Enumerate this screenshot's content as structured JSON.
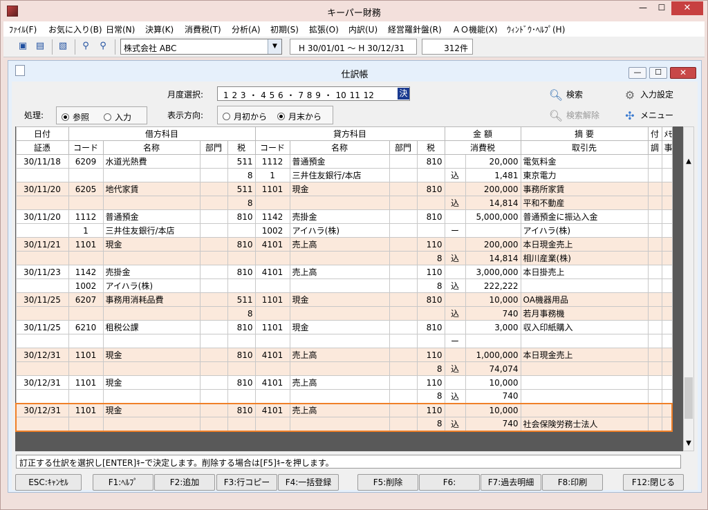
{
  "window": {
    "title": "キーパー財務",
    "min": "—",
    "max": "☐",
    "close": "✕"
  },
  "menu": [
    {
      "label": "ﾌｧｲﾙ(F)"
    },
    {
      "label": "お気に入り(B)"
    },
    {
      "label": "日常(N)"
    },
    {
      "label": "決算(K)"
    },
    {
      "label": "消費税(T)"
    },
    {
      "label": "分析(A)"
    },
    {
      "label": "初期(S)"
    },
    {
      "label": "拡張(O)"
    },
    {
      "label": "内訳(U)"
    },
    {
      "label": "経営羅針盤(R)"
    },
    {
      "label": "ＡＯ機能(X)"
    },
    {
      "label": "ｳｨﾝﾄﾞｳ･ﾍﾙﾌﾟ(H)"
    }
  ],
  "toolbar": {
    "company": "株式会社 ABC",
    "period": "H 30/01/01 〜 H 30/12/31",
    "count": "312件"
  },
  "journal": {
    "title": "仕訳帳",
    "month_label": "月度選択:",
    "months_text": "1 2 3 ・ 4 5 6 ・ 7 8 9 ・ 10 11 12",
    "month_selected": "決",
    "process_label": "処理:",
    "process_options": [
      {
        "label": "参照",
        "selected": true
      },
      {
        "label": "入力",
        "selected": false
      }
    ],
    "direction_label": "表示方向:",
    "direction_options": [
      {
        "label": "月初から",
        "selected": false
      },
      {
        "label": "月末から",
        "selected": true
      }
    ],
    "search_label": "検索",
    "search_clear_label": "検索解除",
    "input_settings_label": "入力設定",
    "menu_label": "メニュー",
    "header1": {
      "date": "日付",
      "debit": "借方科目",
      "credit": "貸方科目",
      "amount": "金 額",
      "summary": "摘 要",
      "attach": "付",
      "memo": "ﾒﾓ"
    },
    "header2": {
      "voucher": "証憑",
      "code": "コード",
      "name": "名称",
      "dept": "部門",
      "tax": "税",
      "code2": "コード",
      "name2": "名称",
      "dept2": "部門",
      "tax2": "税",
      "consumption_tax": "消費税",
      "partner": "取引先",
      "adjust": "調",
      "note": "事ﾒﾓ"
    },
    "rows": [
      [
        {
          "date": "30/11/18",
          "dcode": "6209",
          "dname": "水道光熱費",
          "ddept": "",
          "dtax": "511",
          "ccode": "1112",
          "cname": "普通預金",
          "cdept": "",
          "ctax": "810",
          "mark": "",
          "amount": "20,000",
          "summary": "電気料金"
        },
        {
          "date": "",
          "dcode": "",
          "dname": "",
          "ddept": "",
          "dtax": "8",
          "ccode": "1",
          "cname": "三井住友銀行/本店",
          "cdept": "",
          "ctax": "",
          "mark": "込",
          "amount": "1,481",
          "summary": "東京電力"
        }
      ],
      [
        {
          "date": "30/11/20",
          "dcode": "6205",
          "dname": "地代家賃",
          "ddept": "",
          "dtax": "511",
          "ccode": "1101",
          "cname": "現金",
          "cdept": "",
          "ctax": "810",
          "mark": "",
          "amount": "200,000",
          "summary": "事務所家賃"
        },
        {
          "date": "",
          "dcode": "",
          "dname": "",
          "ddept": "",
          "dtax": "8",
          "ccode": "",
          "cname": "",
          "cdept": "",
          "ctax": "",
          "mark": "込",
          "amount": "14,814",
          "summary": "平和不動産"
        }
      ],
      [
        {
          "date": "30/11/20",
          "dcode": "1112",
          "dname": "普通預金",
          "ddept": "",
          "dtax": "810",
          "ccode": "1142",
          "cname": "売掛金",
          "cdept": "",
          "ctax": "810",
          "mark": "",
          "amount": "5,000,000",
          "summary": "普通預金に振込入金"
        },
        {
          "date": "",
          "dcode": "1",
          "dname": "三井住友銀行/本店",
          "ddept": "",
          "dtax": "",
          "ccode": "1002",
          "cname": "アイハラ(株)",
          "cdept": "",
          "ctax": "",
          "mark": "ー",
          "amount": "",
          "summary": "アイハラ(株)"
        }
      ],
      [
        {
          "date": "30/11/21",
          "dcode": "1101",
          "dname": "現金",
          "ddept": "",
          "dtax": "810",
          "ccode": "4101",
          "cname": "売上高",
          "cdept": "",
          "ctax": "110",
          "mark": "",
          "amount": "200,000",
          "summary": "本日現金売上"
        },
        {
          "date": "",
          "dcode": "",
          "dname": "",
          "ddept": "",
          "dtax": "",
          "ccode": "",
          "cname": "",
          "cdept": "",
          "ctax": "8",
          "mark": "込",
          "amount": "14,814",
          "summary": "相川産業(株)"
        }
      ],
      [
        {
          "date": "30/11/23",
          "dcode": "1142",
          "dname": "売掛金",
          "ddept": "",
          "dtax": "810",
          "ccode": "4101",
          "cname": "売上高",
          "cdept": "",
          "ctax": "110",
          "mark": "",
          "amount": "3,000,000",
          "summary": "本日掛売上"
        },
        {
          "date": "",
          "dcode": "1002",
          "dname": "アイハラ(株)",
          "ddept": "",
          "dtax": "",
          "ccode": "",
          "cname": "",
          "cdept": "",
          "ctax": "8",
          "mark": "込",
          "amount": "222,222",
          "summary": ""
        }
      ],
      [
        {
          "date": "30/11/25",
          "dcode": "6207",
          "dname": "事務用消耗品費",
          "ddept": "",
          "dtax": "511",
          "ccode": "1101",
          "cname": "現金",
          "cdept": "",
          "ctax": "810",
          "mark": "",
          "amount": "10,000",
          "summary": "OA機器用品"
        },
        {
          "date": "",
          "dcode": "",
          "dname": "",
          "ddept": "",
          "dtax": "8",
          "ccode": "",
          "cname": "",
          "cdept": "",
          "ctax": "",
          "mark": "込",
          "amount": "740",
          "summary": "若月事務機"
        }
      ],
      [
        {
          "date": "30/11/25",
          "dcode": "6210",
          "dname": "租税公課",
          "ddept": "",
          "dtax": "810",
          "ccode": "1101",
          "cname": "現金",
          "cdept": "",
          "ctax": "810",
          "mark": "",
          "amount": "3,000",
          "summary": "収入印紙購入"
        },
        {
          "date": "",
          "dcode": "",
          "dname": "",
          "ddept": "",
          "dtax": "",
          "ccode": "",
          "cname": "",
          "cdept": "",
          "ctax": "",
          "mark": "ー",
          "amount": "",
          "summary": ""
        }
      ],
      [
        {
          "date": "30/12/31",
          "dcode": "1101",
          "dname": "現金",
          "ddept": "",
          "dtax": "810",
          "ccode": "4101",
          "cname": "売上高",
          "cdept": "",
          "ctax": "110",
          "mark": "",
          "amount": "1,000,000",
          "summary": "本日現金売上"
        },
        {
          "date": "",
          "dcode": "",
          "dname": "",
          "ddept": "",
          "dtax": "",
          "ccode": "",
          "cname": "",
          "cdept": "",
          "ctax": "8",
          "mark": "込",
          "amount": "74,074",
          "summary": ""
        }
      ],
      [
        {
          "date": "30/12/31",
          "dcode": "1101",
          "dname": "現金",
          "ddept": "",
          "dtax": "810",
          "ccode": "4101",
          "cname": "売上高",
          "cdept": "",
          "ctax": "110",
          "mark": "",
          "amount": "10,000",
          "summary": ""
        },
        {
          "date": "",
          "dcode": "",
          "dname": "",
          "ddept": "",
          "dtax": "",
          "ccode": "",
          "cname": "",
          "cdept": "",
          "ctax": "8",
          "mark": "込",
          "amount": "740",
          "summary": ""
        }
      ],
      [
        {
          "date": "30/12/31",
          "dcode": "1101",
          "dname": "現金",
          "ddept": "",
          "dtax": "810",
          "ccode": "4101",
          "cname": "売上高",
          "cdept": "",
          "ctax": "110",
          "mark": "",
          "amount": "10,000",
          "summary": ""
        },
        {
          "date": "",
          "dcode": "",
          "dname": "",
          "ddept": "",
          "dtax": "",
          "ccode": "",
          "cname": "",
          "cdept": "",
          "ctax": "8",
          "mark": "込",
          "amount": "740",
          "summary": "社会保険労務士法人"
        }
      ]
    ],
    "selected_entry": 9,
    "status": "訂正する仕訳を選択し[ENTER]ｷｰで決定します。削除する場合は[F5]ｷｰを押します。",
    "fkeys": [
      {
        "label": "ESC:ｷｬﾝｾﾙ"
      },
      {
        "label": "F1:ﾍﾙﾌﾟ"
      },
      {
        "label": "F2:追加"
      },
      {
        "label": "F3:行コピー"
      },
      {
        "label": "F4:一括登録"
      },
      {
        "label": "F5:削除"
      },
      {
        "label": "F6:"
      },
      {
        "label": "F7:過去明細"
      },
      {
        "label": "F8:印刷"
      },
      {
        "label": "F12:閉じる"
      }
    ]
  },
  "colors": {
    "selection_border": "#f08028",
    "row_alt": "#fbe9dc",
    "month_selected_bg": "#1a3a90",
    "close_button": "#c74040"
  },
  "icons": {
    "search": "magnifier-icon",
    "search_clear": "magnifier-cancel-icon",
    "input_settings": "gear-wrench-icon",
    "menu": "puzzle-icon"
  }
}
